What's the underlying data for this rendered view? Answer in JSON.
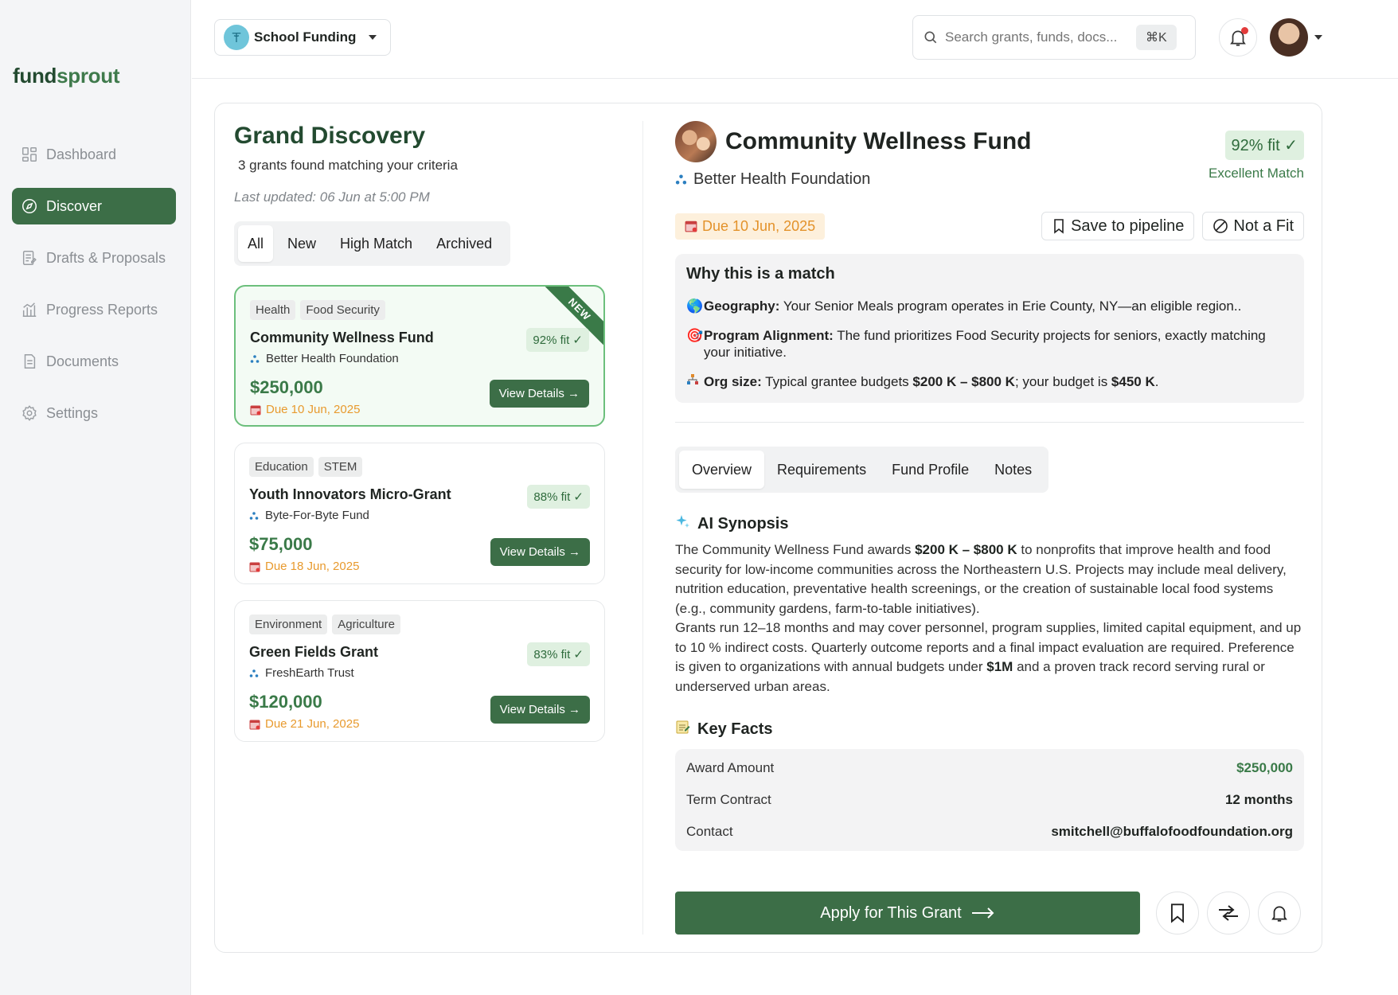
{
  "app": {
    "logo_part1": "fund",
    "logo_part2": "sprout"
  },
  "sidebar": {
    "items": [
      {
        "label": "Dashboard",
        "icon": "dashboard-icon"
      },
      {
        "label": "Discover",
        "icon": "compass-icon",
        "active": true
      },
      {
        "label": "Drafts & Proposals",
        "icon": "drafts-icon"
      },
      {
        "label": "Progress Reports",
        "icon": "chart-icon"
      },
      {
        "label": "Documents",
        "icon": "document-icon"
      },
      {
        "label": "Settings",
        "icon": "gear-icon"
      }
    ]
  },
  "topbar": {
    "workspace": "School Funding",
    "search_placeholder": "Search grants, funds, docs...",
    "search_shortcut": "⌘K"
  },
  "discovery": {
    "title": "Grand Discovery",
    "subtitle": "3 grants found matching your criteria",
    "updated": "Last updated: 06 Jun at 5:00 PM",
    "tabs": [
      "All",
      "New",
      "High Match",
      "Archived"
    ],
    "active_tab": "All",
    "view_details_label": "View Details →",
    "new_label": "NEW",
    "cards": [
      {
        "tags": [
          "Health",
          "Food Security"
        ],
        "title": "Community Wellness Fund",
        "org": "Better Health Foundation",
        "amount": "$250,000",
        "due": "Due 10 Jun, 2025",
        "fit": "92% fit ✓",
        "selected": true
      },
      {
        "tags": [
          "Education",
          "STEM"
        ],
        "title": "Youth Innovators Micro-Grant",
        "org": "Byte-For-Byte Fund",
        "amount": "$75,000",
        "due": "Due 18 Jun, 2025",
        "fit": "88% fit ✓"
      },
      {
        "tags": [
          "Environment",
          "Agriculture"
        ],
        "title": "Green Fields Grant",
        "org": "FreshEarth Trust",
        "amount": "$120,000",
        "due": "Due 21 Jun, 2025",
        "fit": "83% fit ✓"
      }
    ]
  },
  "detail": {
    "title": "Community Wellness Fund",
    "org": "Better Health Foundation",
    "fit": "92% fit ✓",
    "match_label": "Excellent Match",
    "due": "Due 10 Jun, 2025",
    "save_label": "Save to pipeline",
    "notfit_label": "Not a Fit",
    "why": {
      "title": "Why this is a match",
      "items": [
        {
          "label": "Geography:",
          "text": " Your Senior Meals program operates in Erie County, NY—an eligible region.."
        },
        {
          "label": "Program Alignment:",
          "text": " The fund prioritizes Food Security projects for seniors, exactly matching your initiative."
        },
        {
          "label": "Org size:",
          "text_pre": " Typical grantee budgets ",
          "bold1": "$200 K – $800 K",
          "text_mid": "; your budget is ",
          "bold2": "$450 K",
          "text_post": "."
        }
      ]
    },
    "tabs": [
      "Overview",
      "Requirements",
      "Fund Profile",
      "Notes"
    ],
    "active_tab": "Overview",
    "synopsis": {
      "title": "AI Synopsis",
      "p1_a": "The Community Wellness Fund awards ",
      "p1_b": "$200 K – $800 K",
      "p1_c": " to nonprofits that improve health and food security for low-income communities across the Northeastern U.S. Projects may include meal delivery, nutrition education, preventative health screenings, or the creation of sustainable local food systems (e.g., community gardens, farm-to-table initiatives).",
      "p2_a": "Grants run 12–18 months and may cover personnel, program supplies, limited capital equipment, and up to 10 % indirect costs. Quarterly outcome reports and a final impact evaluation are required. Preference is given to organizations with annual budgets under ",
      "p2_b": "$1M",
      "p2_c": " and a proven track record serving rural or underserved urban areas."
    },
    "facts": {
      "title": "Key Facts",
      "rows": [
        {
          "label": "Award Amount",
          "value": "$250,000"
        },
        {
          "label": "Term Contract",
          "value": "12 months"
        },
        {
          "label": "Contact",
          "value": "smitchell@buffalofoodfoundation.org"
        }
      ]
    },
    "apply_label": "Apply for This Grant"
  },
  "colors": {
    "brand": "#3c6e47",
    "accent_green": "#3a7a48",
    "due_orange": "#e89a2e"
  }
}
